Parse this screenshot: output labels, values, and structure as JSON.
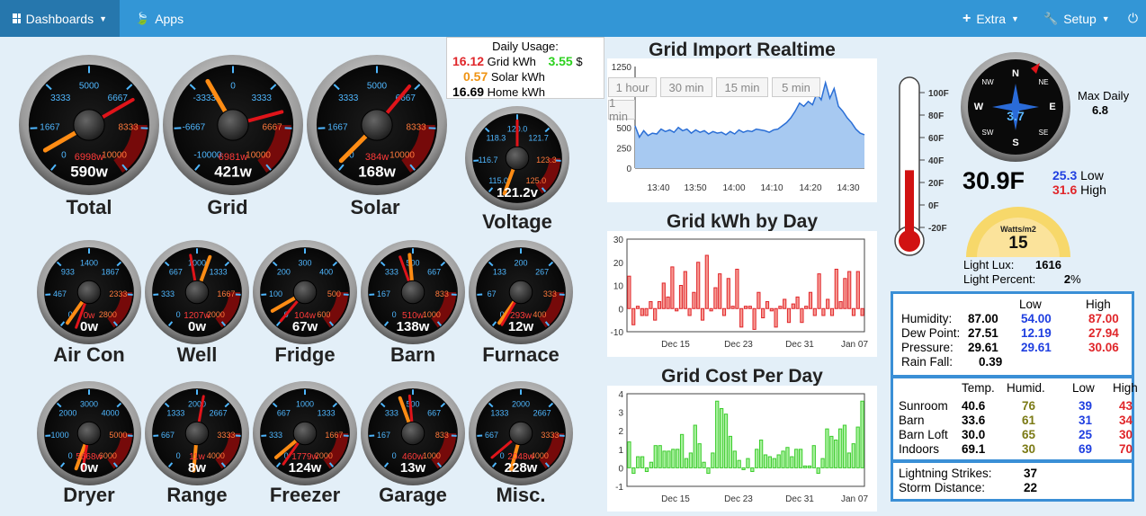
{
  "nav": {
    "dashboards": "Dashboards",
    "apps": "Apps",
    "extra": "Extra",
    "setup": "Setup"
  },
  "gauges": [
    {
      "id": "total",
      "label": "Total",
      "reading": "590w",
      "sub": "6998w",
      "ticks": [
        "0",
        "1667",
        "3333",
        "5000",
        "6667",
        "8333",
        "10000"
      ]
    },
    {
      "id": "grid",
      "label": "Grid",
      "reading": "421w",
      "sub": "6981w",
      "ticks": [
        "-10000",
        "-6667",
        "-3333",
        "0",
        "3333",
        "6667",
        "10000"
      ]
    },
    {
      "id": "solar",
      "label": "Solar",
      "reading": "168w",
      "sub": "384w",
      "ticks": [
        "0",
        "1667",
        "3333",
        "5000",
        "6667",
        "8333",
        "10000"
      ]
    },
    {
      "id": "voltage",
      "label": "Voltage",
      "reading": "121.2v",
      "sub": "",
      "ticks": [
        "115.0",
        "116.7",
        "118.3",
        "120.0",
        "121.7",
        "123.3",
        "125.0"
      ]
    },
    {
      "id": "aircon",
      "label": "Air Con",
      "reading": "0w",
      "sub": "0w",
      "ticks": [
        "0",
        "467",
        "933",
        "1400",
        "1867",
        "2333",
        "2800"
      ]
    },
    {
      "id": "well",
      "label": "Well",
      "reading": "0w",
      "sub": "1207w",
      "ticks": [
        "0",
        "333",
        "667",
        "1000",
        "1333",
        "1667",
        "2000"
      ]
    },
    {
      "id": "fridge",
      "label": "Fridge",
      "reading": "67w",
      "sub": "104w",
      "ticks": [
        "0",
        "100",
        "200",
        "300",
        "400",
        "500",
        "600"
      ]
    },
    {
      "id": "barn",
      "label": "Barn",
      "reading": "138w",
      "sub": "510w",
      "ticks": [
        "0",
        "167",
        "333",
        "500",
        "667",
        "833",
        "1000"
      ]
    },
    {
      "id": "furnace",
      "label": "Furnace",
      "reading": "12w",
      "sub": "293w",
      "ticks": [
        "0",
        "67",
        "133",
        "200",
        "267",
        "333",
        "400"
      ]
    },
    {
      "id": "dryer",
      "label": "Dryer",
      "reading": "0w",
      "sub": "5668w",
      "ticks": [
        "0",
        "1000",
        "2000",
        "3000",
        "4000",
        "5000",
        "6000"
      ]
    },
    {
      "id": "range",
      "label": "Range",
      "reading": "8w",
      "sub": "11w",
      "ticks": [
        "0",
        "667",
        "1333",
        "2000",
        "2667",
        "3333",
        "4000"
      ]
    },
    {
      "id": "freezer",
      "label": "Freezer",
      "reading": "124w",
      "sub": "1779w",
      "ticks": [
        "0",
        "333",
        "667",
        "1000",
        "1333",
        "1667",
        "2000"
      ]
    },
    {
      "id": "garage",
      "label": "Garage",
      "reading": "13w",
      "sub": "460w",
      "ticks": [
        "0",
        "167",
        "333",
        "500",
        "667",
        "833",
        "1000"
      ]
    },
    {
      "id": "misc",
      "label": "Misc.",
      "reading": "228w",
      "sub": "2048w",
      "ticks": [
        "0",
        "667",
        "1333",
        "2000",
        "2667",
        "3333",
        "4000"
      ]
    }
  ],
  "usage": {
    "title": "Daily Usage:",
    "grid_kwh": "16.12",
    "grid_label": "Grid kWh",
    "cost": "3.55",
    "cost_unit": "$",
    "solar_kwh": "0.57",
    "solar_label": "Solar kWh",
    "home_kwh": "16.69",
    "home_label": "Home kWh"
  },
  "realtime": {
    "title": "Grid Import Realtime",
    "buttons": [
      "1 hour",
      "30 min",
      "15 min",
      "5 min",
      "1 min"
    ],
    "yticks": [
      "1250",
      "1000",
      "750",
      "500",
      "250",
      "0"
    ],
    "xticks": [
      "13:40",
      "13:50",
      "14:00",
      "14:10",
      "14:20",
      "14:30"
    ]
  },
  "kwh_by_day": {
    "title": "Grid kWh by Day",
    "yticks": [
      "30",
      "20",
      "10",
      "0",
      "-10"
    ],
    "xticks": [
      "Dec 15",
      "Dec 23",
      "Dec 31",
      "Jan 07"
    ]
  },
  "cost_per_day": {
    "title": "Grid Cost Per Day",
    "yticks": [
      "4",
      "3",
      "2",
      "1",
      "0",
      "-1"
    ],
    "xticks": [
      "Dec 15",
      "Dec 23",
      "Dec 31",
      "Jan 07"
    ]
  },
  "chart_data": [
    {
      "type": "area",
      "title": "Grid Import Realtime",
      "ylim": [
        0,
        1250
      ],
      "x_range": [
        "13:35",
        "14:35"
      ],
      "values": [
        520,
        380,
        460,
        400,
        430,
        420,
        480,
        450,
        470,
        440,
        500,
        460,
        480,
        430,
        470,
        440,
        460,
        420,
        450,
        430,
        440,
        410,
        450,
        420,
        470,
        440,
        460,
        450,
        480,
        470,
        460,
        440,
        470,
        480,
        520,
        560,
        620,
        700,
        800,
        760,
        820,
        780,
        920,
        840,
        1050,
        860,
        980,
        760,
        700,
        620,
        560,
        480,
        430,
        410
      ]
    },
    {
      "type": "bar",
      "title": "Grid kWh by Day",
      "ylim": [
        -10,
        30
      ],
      "values": [
        14,
        -7,
        1,
        -3,
        -3,
        3,
        -5,
        3,
        11,
        5,
        18,
        -1,
        10,
        16,
        -3,
        7,
        20,
        -5,
        23,
        -1,
        9,
        15,
        -3,
        13,
        1,
        17,
        -8,
        1,
        1,
        -9,
        7,
        -4,
        3,
        -1,
        -8,
        1,
        4,
        -6,
        2,
        5,
        -6,
        1,
        7,
        -3,
        15,
        -3,
        4,
        -3,
        17,
        3,
        13,
        16,
        -3,
        16,
        -3
      ]
    },
    {
      "type": "bar",
      "title": "Grid Cost Per Day",
      "ylim": [
        -1,
        4
      ],
      "values": [
        1.4,
        -0.3,
        0.6,
        0.6,
        -0.2,
        0.3,
        1.2,
        1.2,
        0.9,
        0.9,
        1.0,
        1.0,
        1.8,
        0.5,
        0.8,
        2.3,
        1.3,
        0.3,
        -0.3,
        0.8,
        3.6,
        3.2,
        2.9,
        1.7,
        0.9,
        0.4,
        -0.1,
        0.5,
        -0.2,
        1.0,
        1.5,
        0.7,
        0.6,
        0.5,
        0.7,
        0.9,
        1.1,
        0.6,
        1.0,
        1.0,
        0.1,
        0.1,
        1.2,
        -0.3,
        0.5,
        2.1,
        1.7,
        1.5,
        2.1,
        2.3,
        0.8,
        1.3,
        2.2,
        3.6
      ]
    }
  ],
  "thermometer": {
    "ticks": [
      "100F",
      "80F",
      "60F",
      "40F",
      "20F",
      "0F",
      "-20F"
    ],
    "level_f": 30.9
  },
  "wind": {
    "speed": "3.7",
    "dirs": [
      "N",
      "NE",
      "E",
      "SE",
      "S",
      "SW",
      "W",
      "NW"
    ],
    "max_label": "Max Daily",
    "max_value": "6.8"
  },
  "temp": {
    "current": "30.9F",
    "low": "25.3",
    "low_label": "Low",
    "high": "31.6",
    "high_label": "High"
  },
  "solar_rad": {
    "unit": "Watts/m2",
    "value": "15",
    "lux_label": "Light Lux:",
    "lux": "1616",
    "pct_label": "Light Percent:",
    "pct": "2",
    "pct_unit": "%"
  },
  "weather": {
    "low_h": "Low",
    "high_h": "High",
    "rows": [
      {
        "label": "Humidity:",
        "value": "87.00",
        "low": "54.00",
        "high": "87.00"
      },
      {
        "label": "Dew Point:",
        "value": "27.51",
        "low": "12.19",
        "high": "27.94"
      },
      {
        "label": "Pressure:",
        "value": "29.61",
        "low": "29.61",
        "high": "30.06"
      },
      {
        "label": "Rain Fall:",
        "value": "0.39",
        "low": "",
        "high": ""
      }
    ]
  },
  "rooms": {
    "headers": [
      "Temp.",
      "Humid.",
      "Low",
      "High"
    ],
    "rows": [
      {
        "name": "Sunroom",
        "temp": "40.6",
        "humid": "76",
        "low": "39",
        "high": "43"
      },
      {
        "name": "Barn",
        "temp": "33.6",
        "humid": "61",
        "low": "31",
        "high": "34"
      },
      {
        "name": "Barn Loft",
        "temp": "30.0",
        "humid": "65",
        "low": "25",
        "high": "30"
      },
      {
        "name": "Indoors",
        "temp": "69.1",
        "humid": "30",
        "low": "69",
        "high": "70"
      }
    ]
  },
  "lightning": {
    "strikes_label": "Lightning Strikes:",
    "strikes": "37",
    "distance_label": "Storm Distance:",
    "distance": "22"
  }
}
